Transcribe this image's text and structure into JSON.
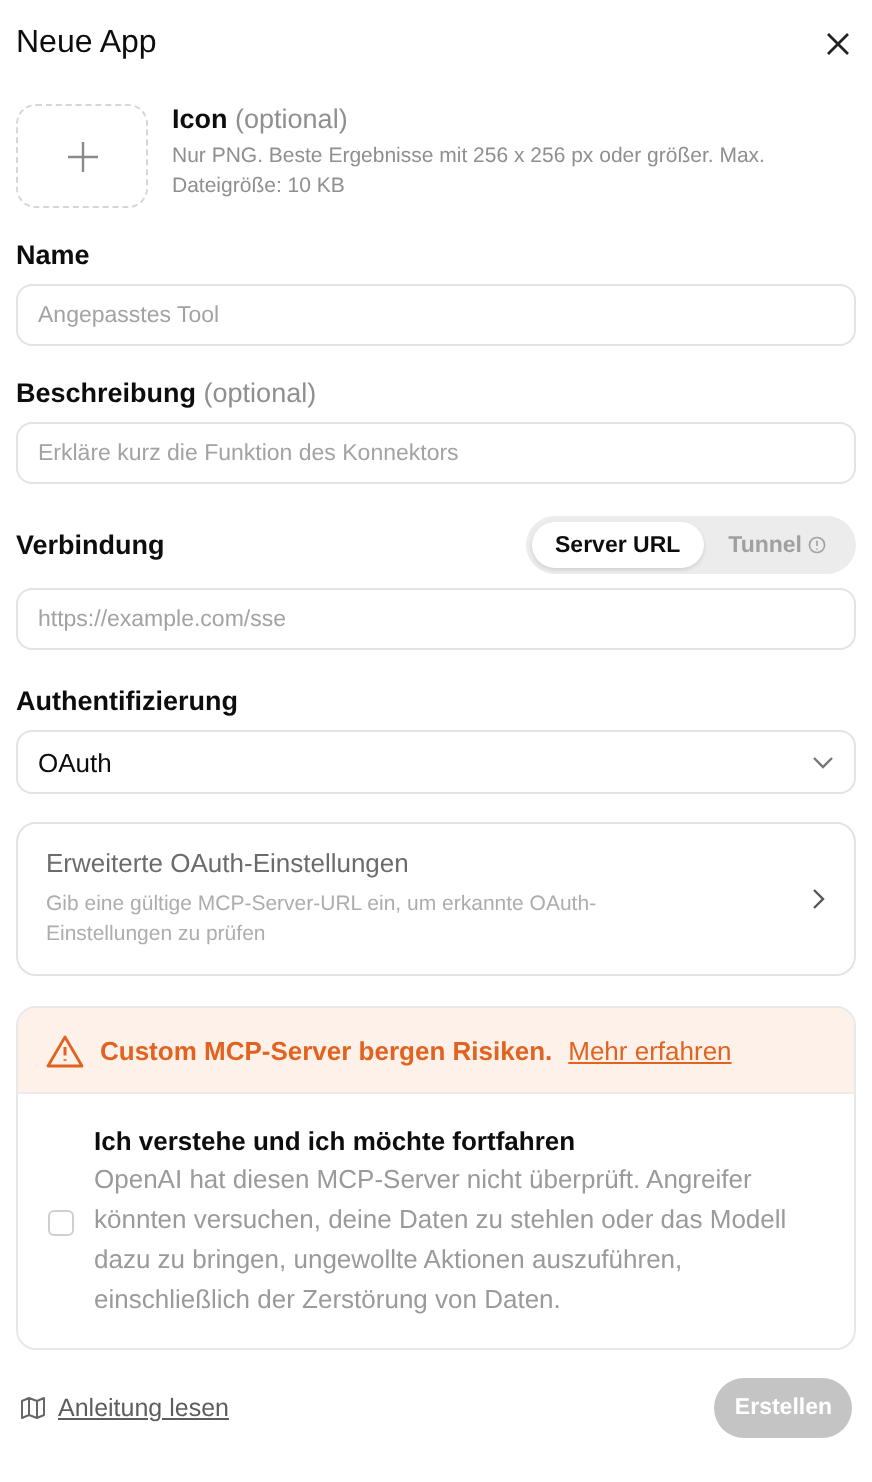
{
  "dialog": {
    "title": "Neue App"
  },
  "icon_upload": {
    "label": "Icon",
    "optional": "(optional)",
    "hint": "Nur PNG. Beste Ergebnisse mit 256 x 256 px oder größer. Max. Dateigröße: 10 KB"
  },
  "fields": [
    {
      "label": "Name",
      "placeholder": "Angepasstes Tool"
    },
    {
      "label": "Beschreibung",
      "optional": "(optional)",
      "placeholder": "Erkläre kurz die Funktion des Konnektors"
    }
  ],
  "connection": {
    "label": "Verbindung",
    "placeholder": "https://example.com/sse",
    "modes": [
      {
        "label": "Server URL",
        "selected": true,
        "info": false
      },
      {
        "label": "Tunnel",
        "selected": false,
        "info": true
      }
    ]
  },
  "authentication": {
    "label": "Authentifizierung",
    "value": "OAuth"
  },
  "advanced": {
    "title": "Erweiterte OAuth-Einstellungen",
    "description": "Gib eine gültige MCP-Server-URL ein, um erkannte OAuth-Einstellungen zu prüfen",
    "disabled": true
  },
  "warning": {
    "text": "Custom MCP-Server bergen Risiken.",
    "link": "Mehr erfahren"
  },
  "consent": {
    "title": "Ich verstehe und ich möchte fortfahren",
    "description": "OpenAI hat diesen MCP-Server nicht überprüft. Angreifer könnten versuchen, deine Daten zu stehlen oder das Modell dazu zu bringen, ungewollte Aktionen auszuführen, einschließlich der Zerstörung von Daten.",
    "checked": false
  },
  "footer": {
    "guide_link": "Anleitung lesen",
    "submit": {
      "label": "Erstellen",
      "disabled": true
    }
  }
}
